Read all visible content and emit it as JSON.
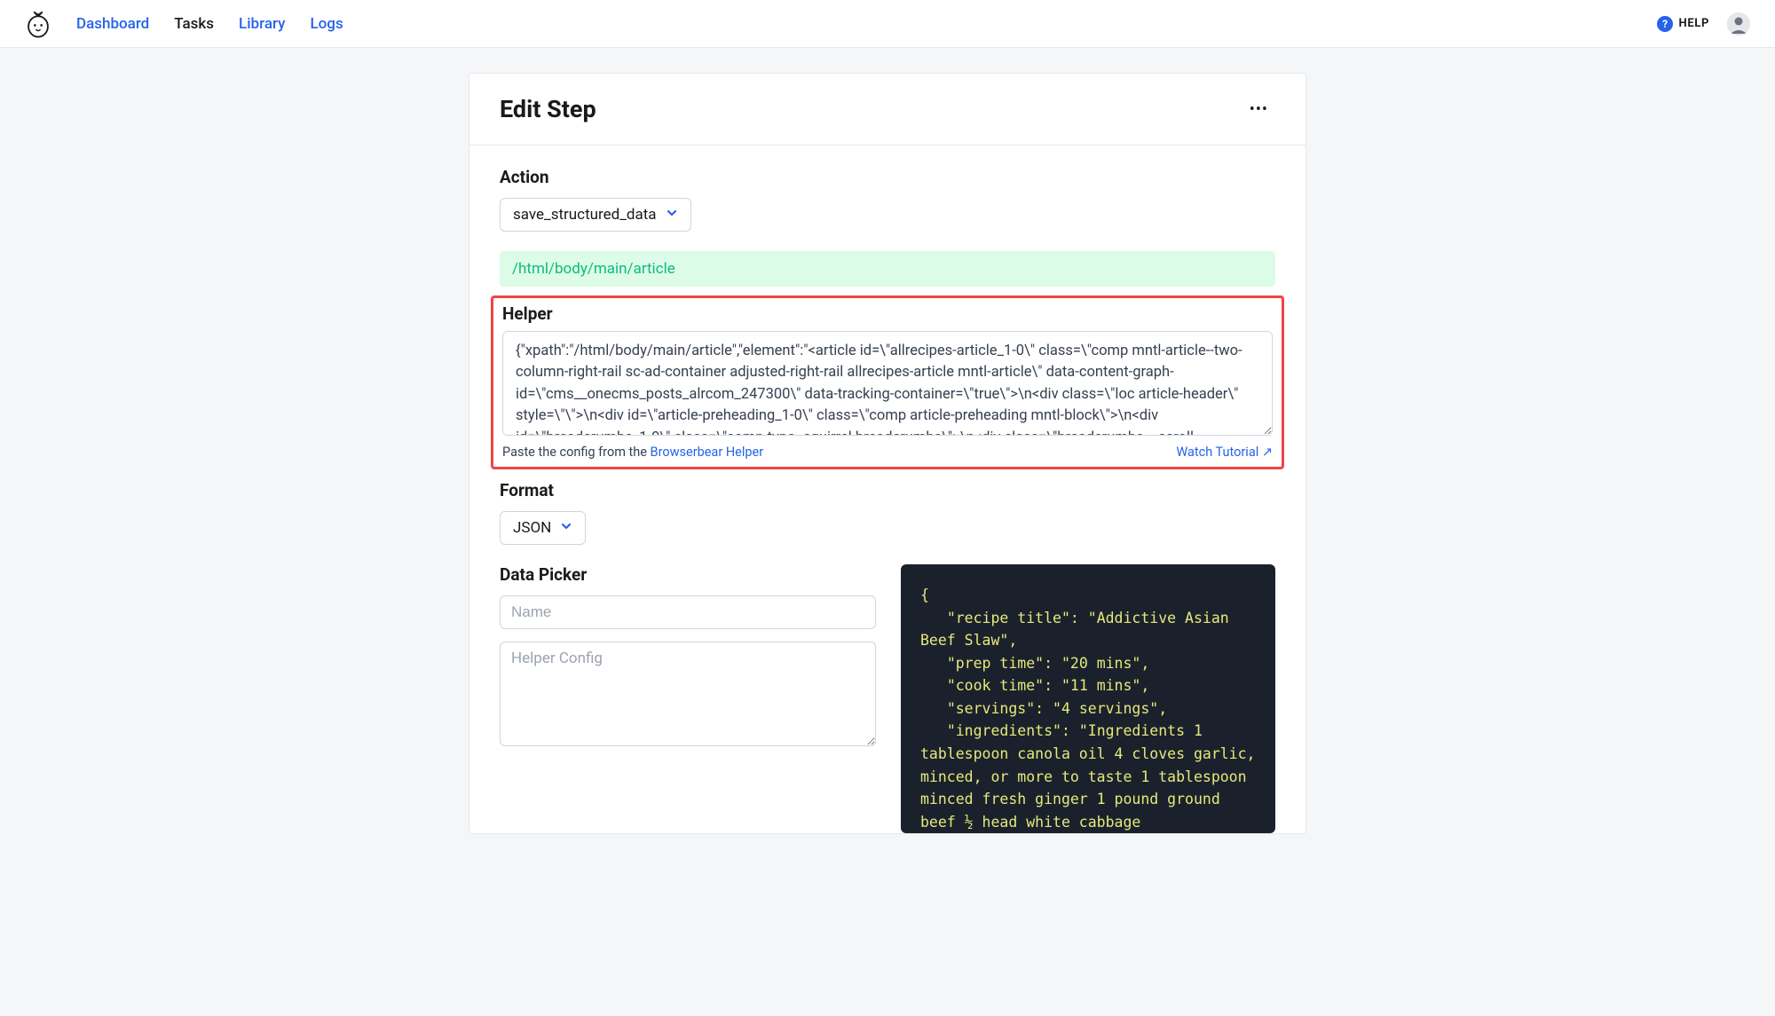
{
  "nav": {
    "dashboard": "Dashboard",
    "tasks": "Tasks",
    "library": "Library",
    "logs": "Logs"
  },
  "header": {
    "help_label": "HELP"
  },
  "card": {
    "title": "Edit Step",
    "more": "•••"
  },
  "action": {
    "label": "Action",
    "value": "save_structured_data"
  },
  "xpath_banner": "/html/body/main/article",
  "helper": {
    "label": "Helper",
    "textarea_value": "{\"xpath\":\"/html/body/main/article\",\"element\":\"<article id=\\\"allrecipes-article_1-0\\\" class=\\\"comp mntl-article--two-column-right-rail sc-ad-container adjusted-right-rail allrecipes-article mntl-article\\\" data-content-graph-id=\\\"cms__onecms_posts_alrcom_247300\\\" data-tracking-container=\\\"true\\\">\\n<div class=\\\"loc article-header\\\" style=\\\"\\\">\\n<div id=\\\"article-preheading_1-0\\\" class=\\\"comp article-preheading mntl-block\\\">\\n<div id=\\\"breadcrumbs_1-0\\\" class=\\\"comp type--squirrel breadcrumbs\\\">\\n<div class=\\\"breadcrumbs    scroll",
    "footer_prefix": "Paste the config from the ",
    "footer_link": "Browserbear Helper",
    "watch_tutorial": "Watch Tutorial ↗"
  },
  "format": {
    "label": "Format",
    "value": "JSON"
  },
  "data_picker": {
    "label": "Data Picker",
    "name_placeholder": "Name",
    "config_placeholder": "Helper Config"
  },
  "preview_code": "{\n   \"recipe title\": \"Addictive Asian Beef Slaw\",\n   \"prep time\": \"20 mins\",\n   \"cook time\": \"11 mins\",\n   \"servings\": \"4 servings\",\n   \"ingredients\": \"Ingredients 1 tablespoon canola oil 4 cloves garlic, minced, or more to taste 1 tablespoon minced fresh ginger 1 pound ground beef ½ head white cabbage"
}
